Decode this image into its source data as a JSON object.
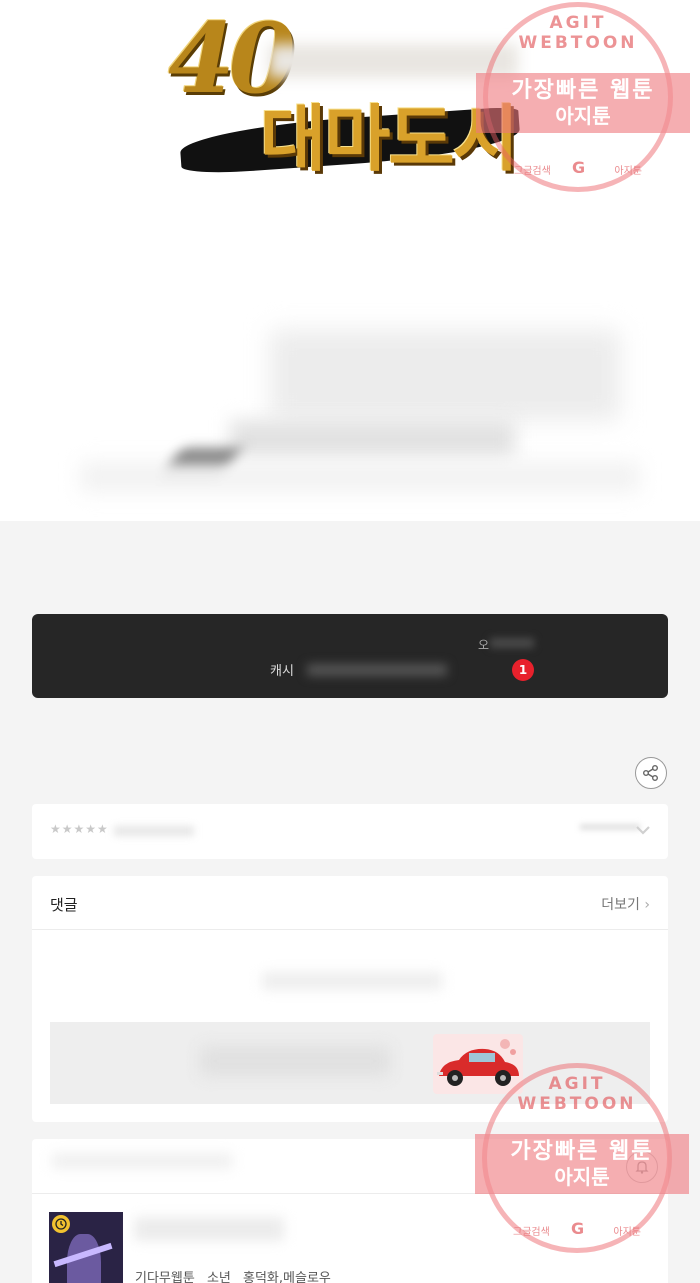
{
  "hero": {
    "logo_number": "40",
    "logo_title": "대마도시"
  },
  "dark_bar": {
    "cash_label": "캐시",
    "small_label": "오",
    "badge_count": "1"
  },
  "rating": {
    "stars": "★★★★★"
  },
  "comments": {
    "title": "댓글",
    "more_label": "더보기",
    "more_chevron": "›"
  },
  "list_item": {
    "meta": [
      "기다무웹툰",
      "소년",
      "홍덕화,메슬로우"
    ]
  },
  "watermark": {
    "ring_text": "AGIT WEBTOON",
    "line1": "가장빠른 웹툰",
    "line2": "아지툰",
    "foot_left": "그글검색",
    "foot_right": "아지툰",
    "g_letter": "G"
  },
  "colors": {
    "badge": "#e8212c",
    "dark_bar": "#262626",
    "watermark": "#eb5f64"
  },
  "icons": [
    "share-icon",
    "chevron-down-icon",
    "chevron-right-icon",
    "clock-icon",
    "bell-icon"
  ]
}
